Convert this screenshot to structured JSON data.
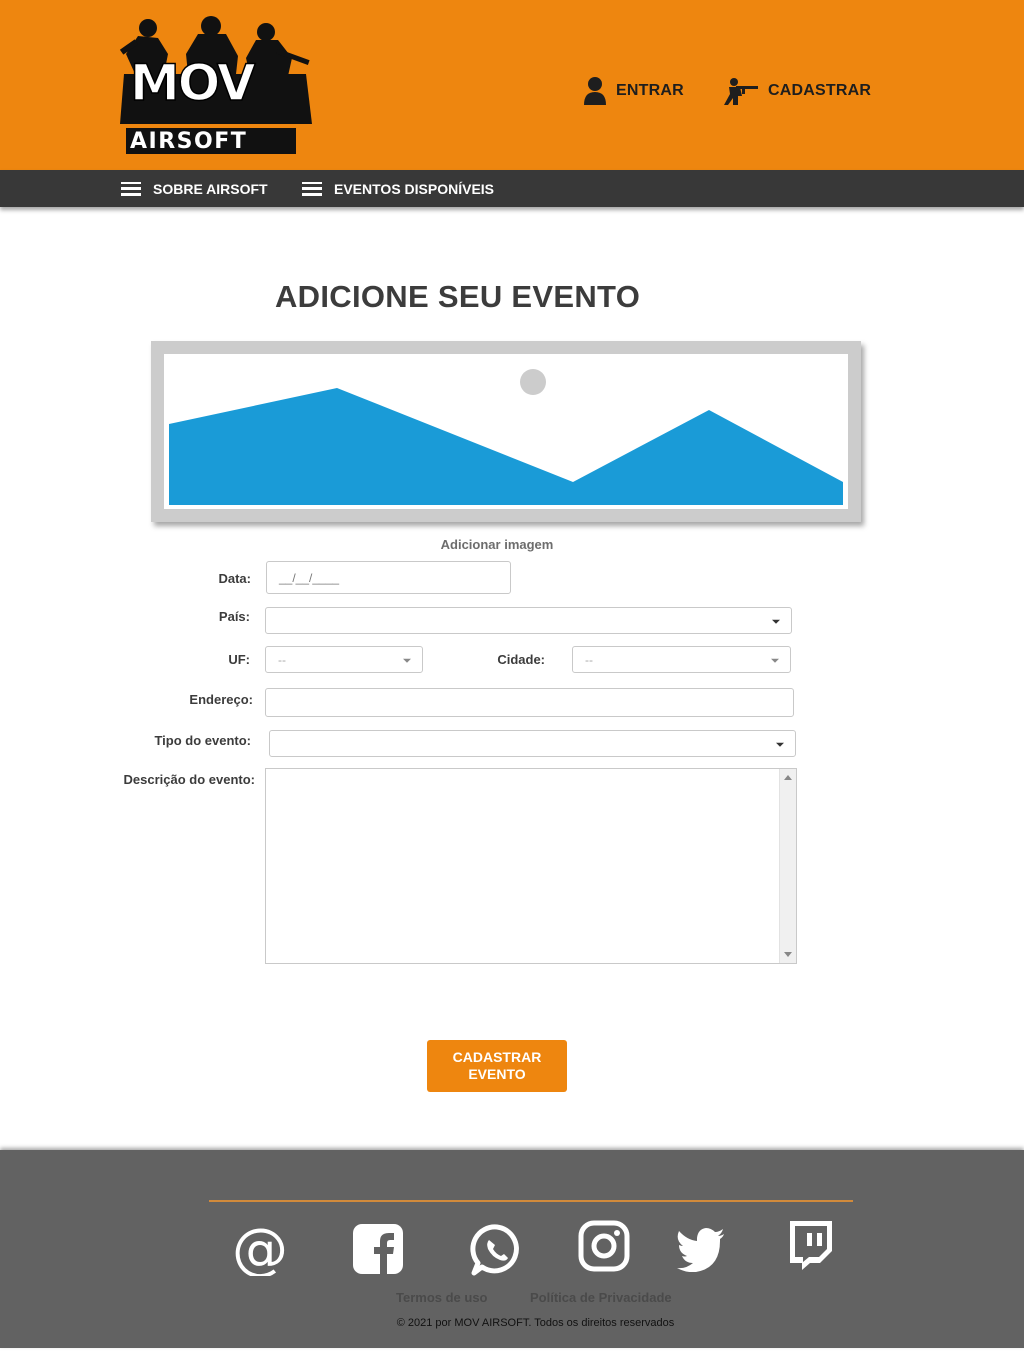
{
  "header": {
    "logo_text_top": "MOV",
    "logo_text_bottom": "AIRSOFT",
    "login_label": "ENTRAR",
    "signup_label": "CADASTRAR"
  },
  "nav": {
    "items": [
      {
        "label": "SOBRE AIRSOFT",
        "icon": "menu-icon"
      },
      {
        "label": "EVENTOS DISPONÍVEIS",
        "icon": "menu-icon"
      }
    ]
  },
  "main": {
    "title": "ADICIONE SEU EVENTO",
    "image_placeholder_icon": "image-placeholder-icon",
    "add_image_label": "Adicionar imagem",
    "form": {
      "date_label": "Data:",
      "date_value": "__/__/____",
      "country_label": "País:",
      "country_value": "",
      "uf_label": "UF:",
      "uf_value": "--",
      "city_label": "Cidade:",
      "city_value": "--",
      "address_label": "Endereço:",
      "address_value": "",
      "event_type_label": "Tipo do evento:",
      "event_type_value": "",
      "description_label": "Descrição do evento:",
      "description_value": ""
    },
    "submit_label_line1": "CADASTRAR",
    "submit_label_line2": "EVENTO"
  },
  "footer": {
    "social_icons": [
      "email-icon",
      "facebook-icon",
      "whatsapp-icon",
      "instagram-icon",
      "twitter-icon",
      "twitch-icon"
    ],
    "terms_label": "Termos de uso",
    "privacy_label": "Política de Privacidade",
    "copyright": "© 2021 por MOV AIRSOFT.  Todos os direitos reservados"
  },
  "colors": {
    "brand_orange": "#ee860f",
    "nav_dark": "#383838",
    "footer_gray": "#626262",
    "image_blue": "#1a9bd7"
  }
}
